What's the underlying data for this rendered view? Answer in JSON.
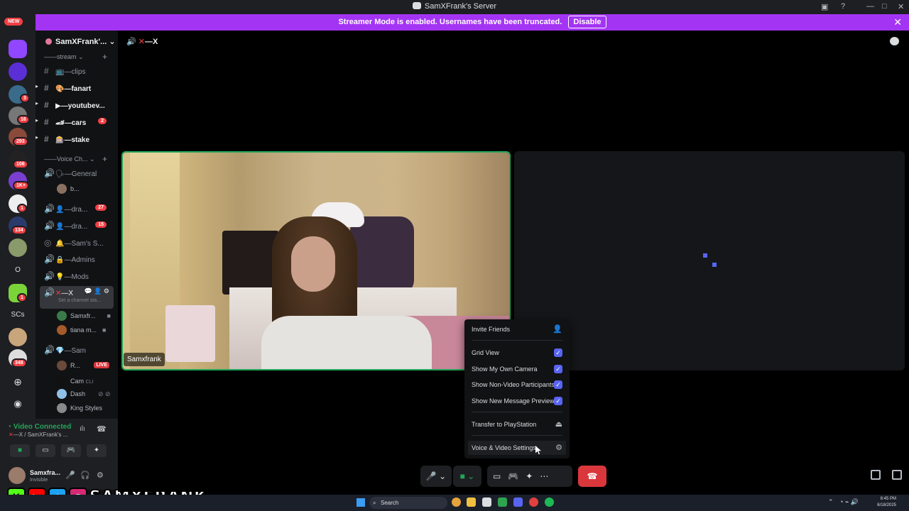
{
  "window": {
    "title": "SamXFrank's Server"
  },
  "banner": {
    "message": "Streamer Mode is enabled. Usernames have been truncated.",
    "disable_label": "Disable"
  },
  "rail": {
    "new_label": "NEW",
    "badges": [
      "55",
      "3",
      "16",
      "293",
      "106",
      "1K+",
      "1",
      "134",
      "1",
      "348"
    ],
    "text_servers": [
      "O",
      "SCs"
    ]
  },
  "sidebar": {
    "server_name": "SamXFrank'...",
    "category_stream": "——stream",
    "category_voice": "——Voice Ch...",
    "text_channels": [
      {
        "name": "📺—clips"
      },
      {
        "name": "🎨—fanart"
      },
      {
        "name": "▶—youtubev..."
      },
      {
        "name": "🏎—cars",
        "count": "2"
      },
      {
        "name": "🎰—stake"
      }
    ],
    "voice_channels": [
      {
        "name": "🗣—General"
      },
      {
        "name": "👤—dra...",
        "count": "27"
      },
      {
        "name": "👤—dra...",
        "count": "15"
      },
      {
        "name": "🔔—Sam's S..."
      },
      {
        "name": "🔒—Admins"
      },
      {
        "name": "💡—Mods"
      },
      {
        "name": "—X"
      },
      {
        "name": "💎—Sam"
      }
    ],
    "general_user": "b...",
    "channel_status_placeholder": "Set a channel sta...",
    "x_users": [
      "Samxfr...",
      "tiana m..."
    ],
    "sam_users": [
      "R...",
      "Cam",
      "Dash",
      "King Styles"
    ],
    "live_label": "LIVE",
    "cam_tag": "CLI"
  },
  "voice_panel": {
    "status": "Video Connected",
    "channel": "—X / SamXFrank's ..."
  },
  "user_panel": {
    "name": "Samxfra...",
    "status": "Invisible"
  },
  "overlay": {
    "handle": "SAMXFRANK"
  },
  "main": {
    "channel_title": "—X",
    "participant_name": "Samxfrank"
  },
  "menu": {
    "invite": "Invite Friends",
    "grid_view": "Grid View",
    "own_camera": "Show My Own Camera",
    "non_video": "Show Non-Video Participants",
    "message_previews": "Show New Message Previews",
    "transfer": "Transfer to PlayStation",
    "settings": "Voice & Video Settings",
    "checks": {
      "grid_view": true,
      "own_camera": true,
      "non_video": true,
      "message_previews": true
    }
  },
  "taskbar": {
    "search_placeholder": "Search",
    "time": "8:45 PM",
    "date": "6/18/2025"
  },
  "colors": {
    "accent": "#5865f2",
    "banner": "#a434f4",
    "connected": "#23a55a",
    "danger": "#da373c"
  }
}
